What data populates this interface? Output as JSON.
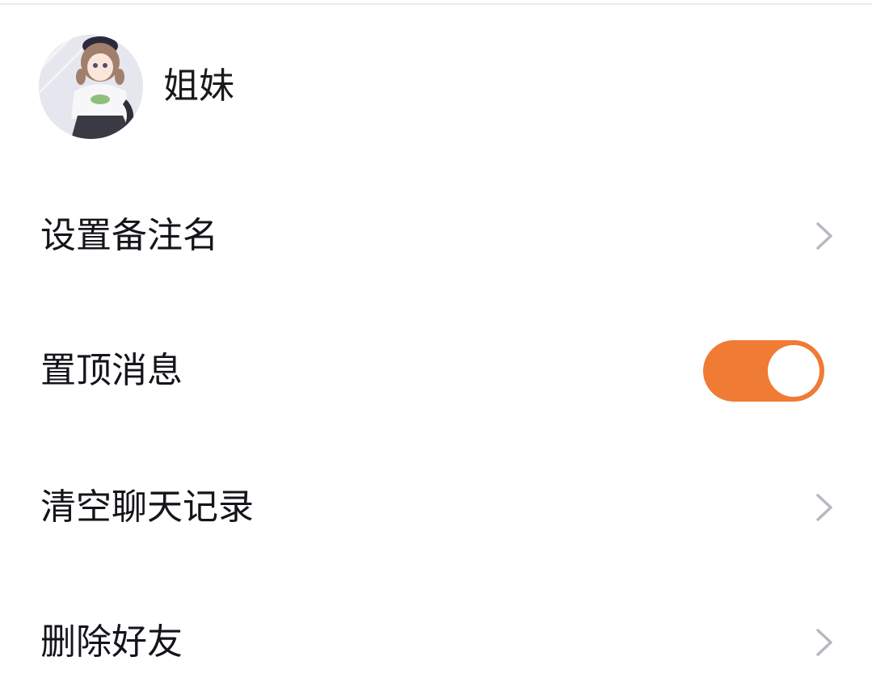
{
  "contact": {
    "name": "姐妹",
    "avatar_icon": "anime-girl-avatar"
  },
  "settings": [
    {
      "label": "设置备注名",
      "control": "chevron-right-icon"
    },
    {
      "label": "置顶消息",
      "control": "toggle",
      "on": true
    },
    {
      "label": "清空聊天记录",
      "control": "chevron-right-icon"
    },
    {
      "label": "删除好友",
      "control": "chevron-right-icon"
    }
  ],
  "colors": {
    "toggle_on": "#ef7b35",
    "chevron": "#b8b9bf",
    "text": "#14141a",
    "divider": "#ececee"
  }
}
